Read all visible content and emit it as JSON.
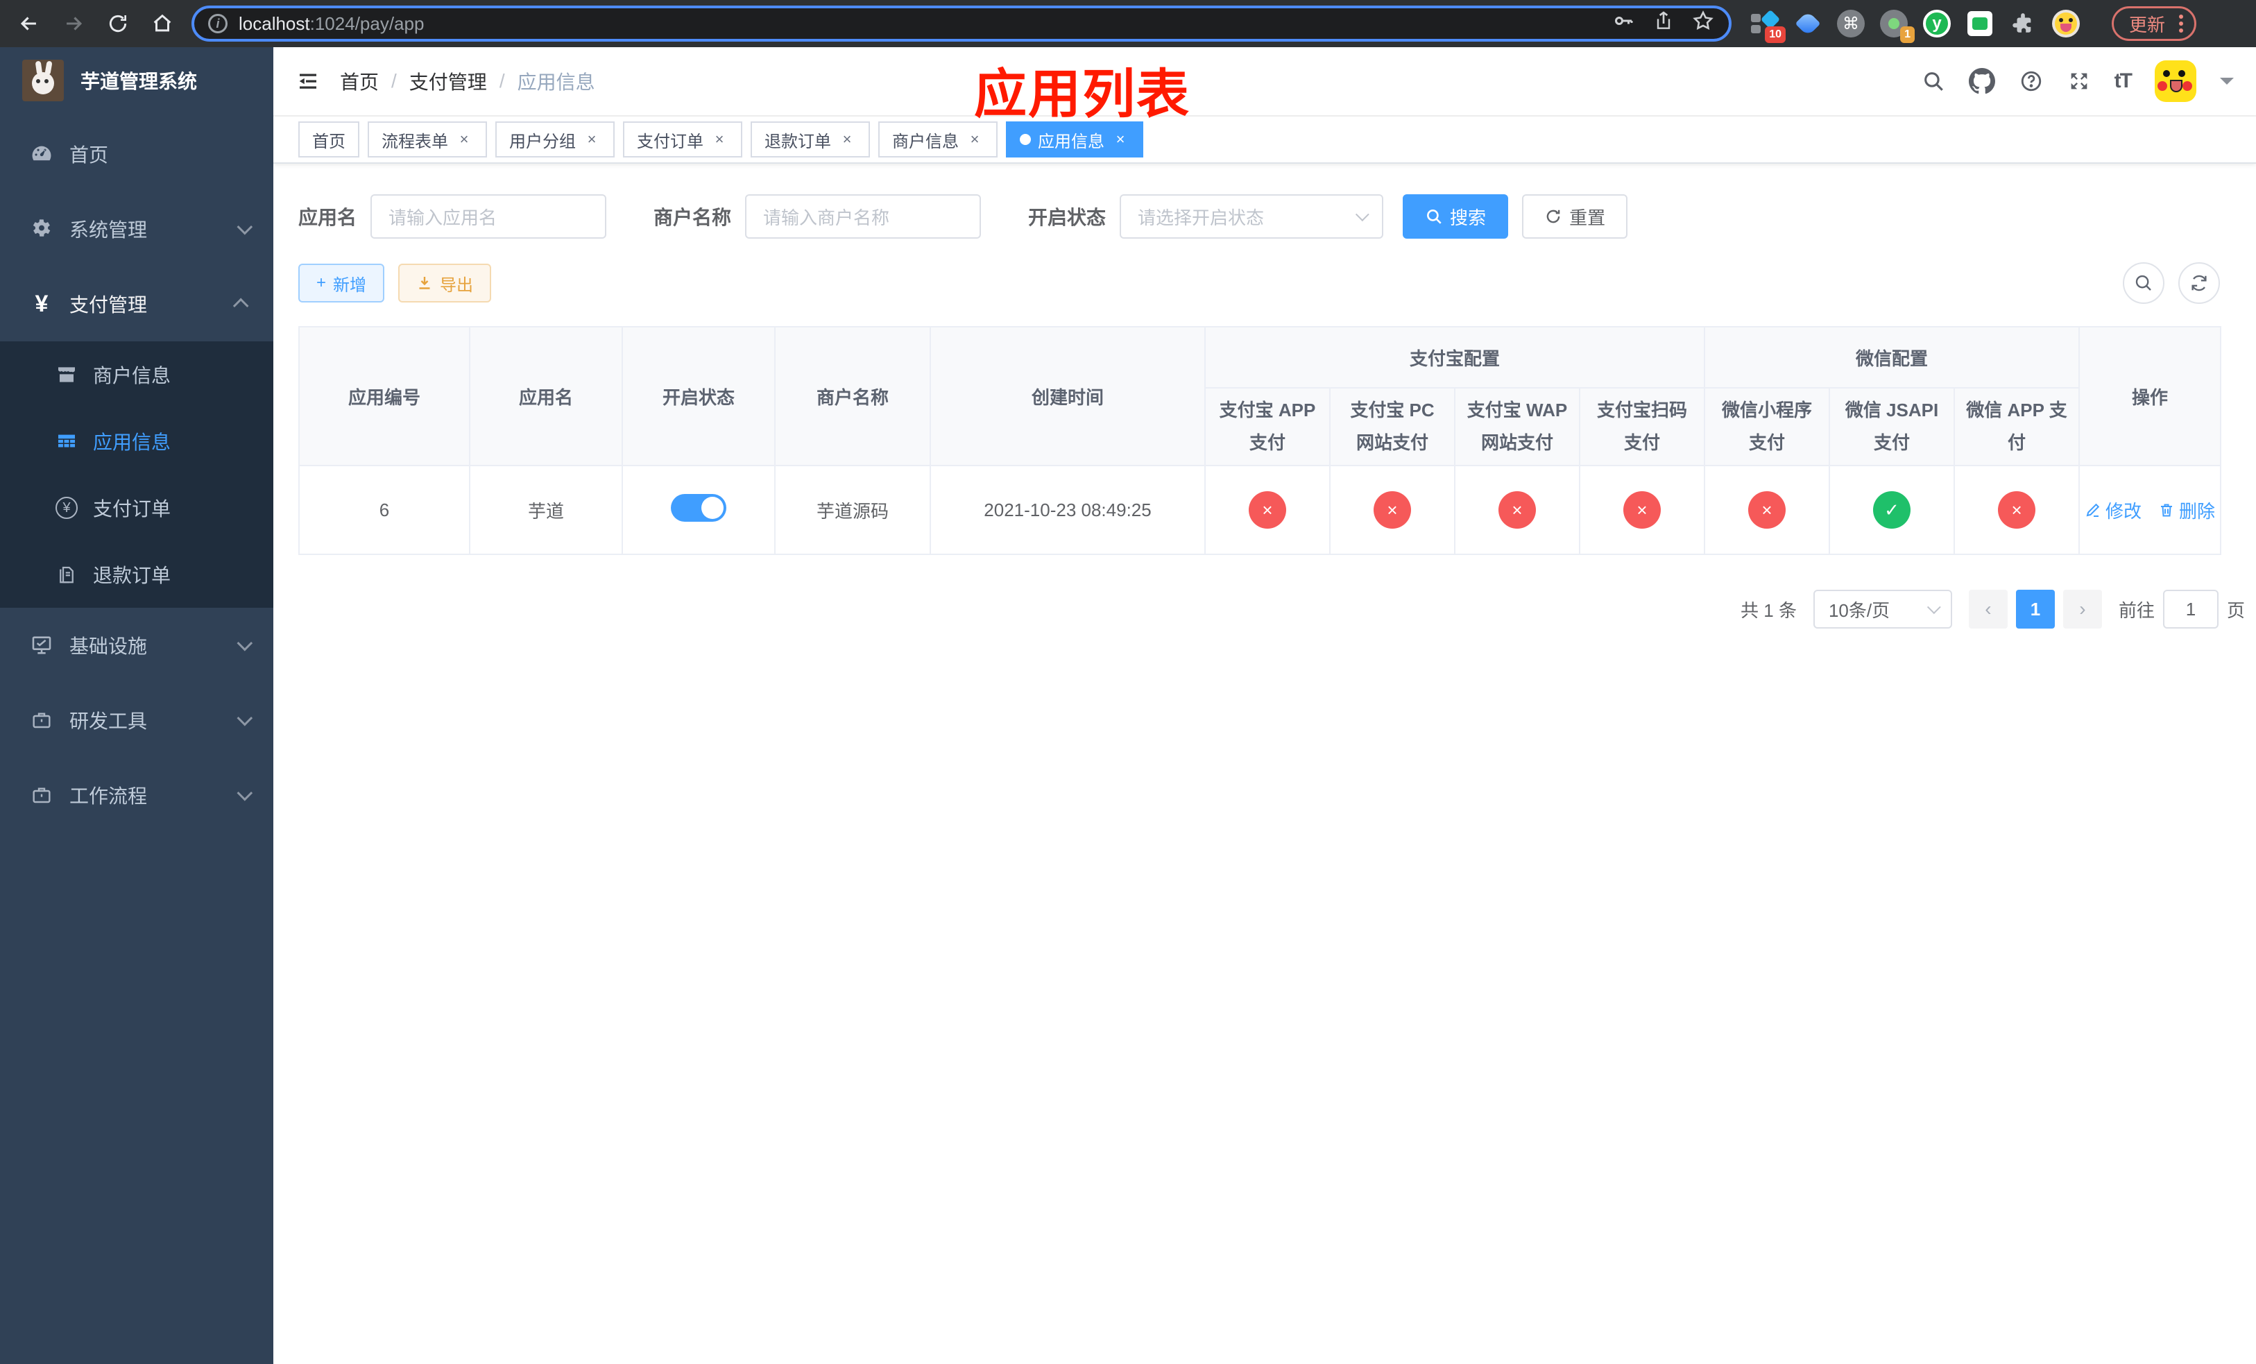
{
  "colors": {
    "accent": "#409eff",
    "danger_circle": "#f65959",
    "success_circle": "#1fc06a",
    "sidebar_bg": "#304156",
    "submenu_bg": "#1f2d3d",
    "annotation_red": "#ff1a00",
    "update_button": "#ee8a80",
    "url_focus_ring": "#4d8bf8"
  },
  "browser": {
    "url": {
      "host": "localhost",
      "rest": ":1024/pay/app"
    },
    "extensions": {
      "badge_axure": "10",
      "badge_record": "1",
      "y_label": "y",
      "command_glyph": "⌘"
    },
    "update_label": "更新"
  },
  "sidebar": {
    "title": "芋道管理系统",
    "items": [
      {
        "label": "首页"
      },
      {
        "label": "系统管理"
      },
      {
        "label": "支付管理"
      },
      {
        "label": "基础设施"
      },
      {
        "label": "研发工具"
      },
      {
        "label": "工作流程"
      }
    ],
    "subitems": [
      {
        "label": "商户信息"
      },
      {
        "label": "应用信息"
      },
      {
        "label": "支付订单"
      },
      {
        "label": "退款订单"
      }
    ],
    "yen_glyph": "¥"
  },
  "navbar": {
    "breadcrumb": [
      "首页",
      "支付管理",
      "应用信息"
    ],
    "separator": "/",
    "font_icon_label": "tT"
  },
  "annotation": {
    "title": "应用列表"
  },
  "tabs": [
    {
      "label": "首页"
    },
    {
      "label": "流程表单"
    },
    {
      "label": "用户分组"
    },
    {
      "label": "支付订单"
    },
    {
      "label": "退款订单"
    },
    {
      "label": "商户信息"
    },
    {
      "label": "应用信息"
    }
  ],
  "tab_close_glyph": "×",
  "filters": {
    "app_name": {
      "label": "应用名",
      "placeholder": "请输入应用名",
      "value": ""
    },
    "merchant": {
      "label": "商户名称",
      "placeholder": "请输入商户名称",
      "value": ""
    },
    "status": {
      "label": "开启状态",
      "placeholder": "请选择开启状态",
      "value": ""
    },
    "search_label": "搜索",
    "reset_label": "重置"
  },
  "toolbar": {
    "add_label": "新增",
    "export_label": "导出"
  },
  "table": {
    "groups": {
      "alipay": "支付宝配置",
      "wechat": "微信配置"
    },
    "columns": {
      "id": "应用编号",
      "name": "应用名",
      "enabled": "开启状态",
      "merchant": "商户名称",
      "created": "创建时间",
      "alipay_app": "支付宝 APP 支付",
      "alipay_pc": "支付宝 PC 网站支付",
      "alipay_wap": "支付宝 WAP 网站支付",
      "alipay_qr": "支付宝扫码支付",
      "wx_lite": "微信小程序支付",
      "wx_jsapi": "微信 JSAPI 支付",
      "wx_app": "微信 APP 支付",
      "ops": "操作"
    },
    "row": {
      "id": "6",
      "name": "芋道",
      "enabled": true,
      "merchant": "芋道源码",
      "created": "2021-10-23 08:49:25",
      "pay_statuses": [
        {
          "name": "alipay-app",
          "enabled": false,
          "glyph": "×"
        },
        {
          "name": "alipay-pc",
          "enabled": false,
          "glyph": "×"
        },
        {
          "name": "alipay-wap",
          "enabled": false,
          "glyph": "×"
        },
        {
          "name": "alipay-qr",
          "enabled": false,
          "glyph": "×"
        },
        {
          "name": "wx-lite",
          "enabled": false,
          "glyph": "×"
        },
        {
          "name": "wx-jsapi",
          "enabled": true,
          "glyph": "✓"
        },
        {
          "name": "wx-app",
          "enabled": false,
          "glyph": "×"
        }
      ],
      "edit_label": "修改",
      "delete_label": "删除"
    }
  },
  "pagination": {
    "total_text": "共 1 条",
    "page_size": "10条/页",
    "prev_glyph": "‹",
    "next_glyph": "›",
    "current_page": "1",
    "goto_prefix": "前往",
    "goto_value": "1",
    "goto_suffix": "页"
  }
}
